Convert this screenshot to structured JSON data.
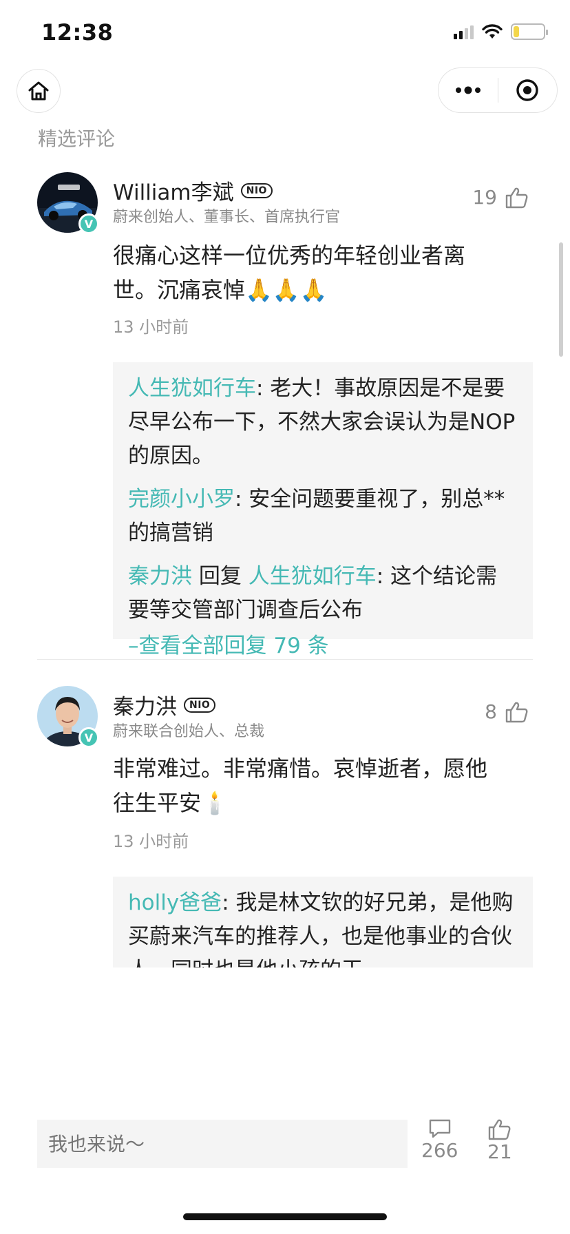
{
  "status_bar": {
    "time": "12:38",
    "battery_level": 0.2
  },
  "header": {
    "section_title": "精选评论"
  },
  "comments": [
    {
      "name": "William李斌",
      "brand": "NIO",
      "title": "蔚来创始人、董事长、首席执行官",
      "likes": "19",
      "body": "很痛心这样一位优秀的年轻创业者离世。沉痛哀悼🙏🙏🙏",
      "time": "13 小时前",
      "replies": [
        {
          "name": "人生犹如行车",
          "text": ": 老大！事故原因是不是要尽早公布一下，不然大家会误认为是NOP的原因。"
        },
        {
          "name": "完颜小小罗",
          "text": ": 安全问题要重视了，别总**的搞营销"
        },
        {
          "name": "秦力洪",
          "connector": " 回复 ",
          "target": "人生犹如行车",
          "text": ": 这个结论需要等交管部门调查后公布"
        }
      ],
      "more_replies": "–查看全部回复 79 条"
    },
    {
      "name": "秦力洪",
      "brand": "NIO",
      "title": "蔚来联合创始人、总裁",
      "likes": "8",
      "body": "非常难过。非常痛惜。哀悼逝者，愿他往生平安🕯️",
      "time": "13 小时前",
      "replies": [
        {
          "name": "holly爸爸",
          "text": ": 我是林文钦的好兄弟，是他购买蔚来汽车的推荐人，也是他事业的合伙人，同时也是他小孩的干"
        }
      ]
    }
  ],
  "bottom_bar": {
    "input_placeholder": "我也来说～",
    "comment_count": "266",
    "like_count": "21"
  },
  "colors": {
    "accent": "#45b9b4",
    "verified": "#45c4b4"
  }
}
